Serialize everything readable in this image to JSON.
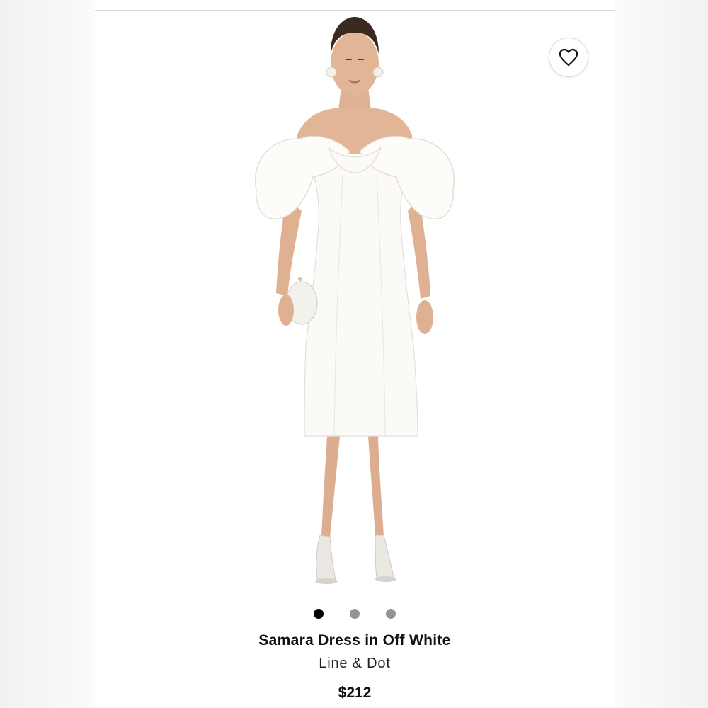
{
  "product": {
    "name": "Samara Dress in Off White",
    "brand": "Line & Dot",
    "price": "$212",
    "image": {
      "subject": "model-wearing-off-shoulder-ruffle-midi-dress",
      "dress_color": "#fbfaf6",
      "skin_color": "#e2b596",
      "hair_color": "#3b2a22"
    }
  },
  "carousel": {
    "slide_count": 3,
    "active_index": 0,
    "active_color": "#000000",
    "inactive_color": "#939393"
  },
  "icons": {
    "favorite": "heart-outline-icon"
  }
}
